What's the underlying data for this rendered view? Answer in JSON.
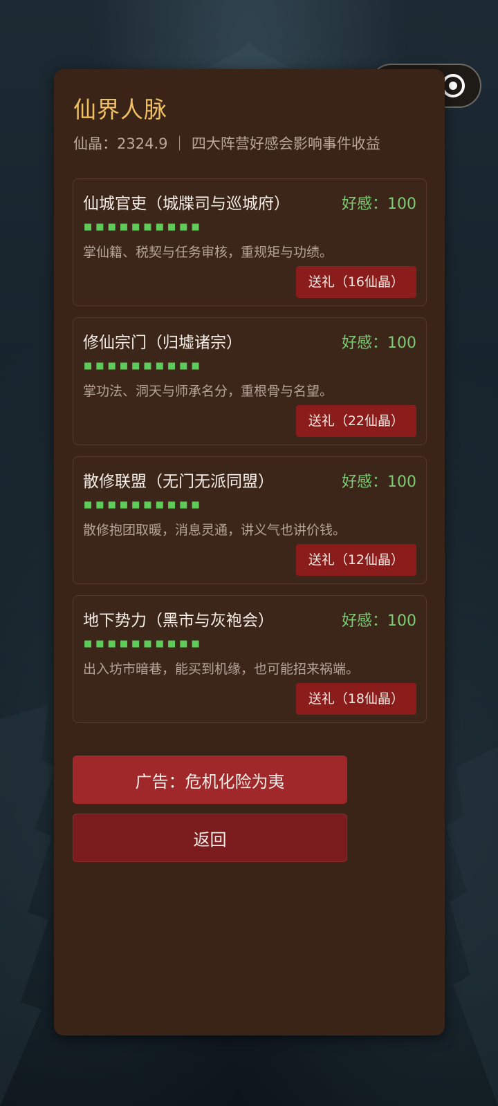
{
  "panel": {
    "title": "仙界人脉",
    "subtitle": "仙晶：2324.9 ｜ 四大阵营好感会影响事件收益"
  },
  "factions": [
    {
      "name": "仙城官吏（城牒司与巡城府）",
      "favor": "好感：100",
      "bar": "■■■■■■■■■■",
      "desc": "掌仙籍、税契与任务审核，重规矩与功绩。",
      "gift": "送礼（16仙晶）"
    },
    {
      "name": "修仙宗门（归墟诸宗）",
      "favor": "好感：100",
      "bar": "■■■■■■■■■■",
      "desc": "掌功法、洞天与师承名分，重根骨与名望。",
      "gift": "送礼（22仙晶）"
    },
    {
      "name": "散修联盟（无门无派同盟）",
      "favor": "好感：100",
      "bar": "■■■■■■■■■■",
      "desc": "散修抱团取暖，消息灵通，讲义气也讲价钱。",
      "gift": "送礼（12仙晶）"
    },
    {
      "name": "地下势力（黑市与灰袍会）",
      "favor": "好感：100",
      "bar": "■■■■■■■■■■",
      "desc": "出入坊市暗巷，能买到机缘，也可能招来祸端。",
      "gift": "送礼（18仙晶）"
    }
  ],
  "buttons": {
    "ad": "广告：危机化险为夷",
    "back": "返回"
  },
  "colors": {
    "title": "#f0c060",
    "favor": "#7ccc74",
    "gift_button": "#8b1c1c",
    "panel": "#3a2418"
  }
}
